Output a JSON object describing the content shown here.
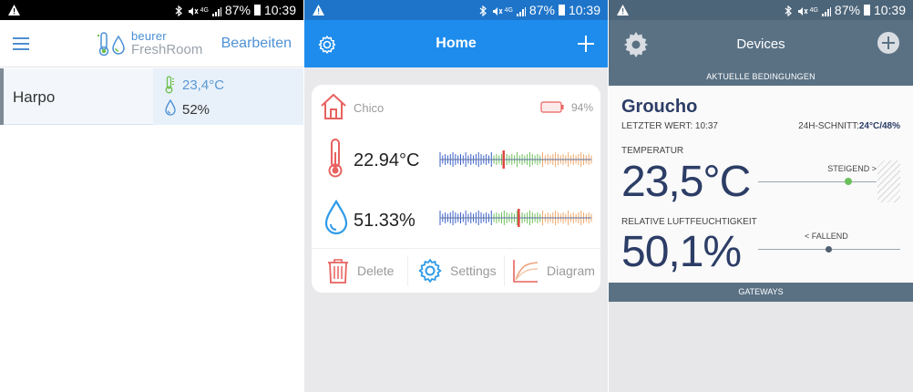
{
  "status": {
    "battery_pct": "87%",
    "time": "10:39",
    "network": "4G"
  },
  "screen1": {
    "edit_label": "Bearbeiten",
    "logo_line1": "beurer",
    "logo_line2": "FreshRoom",
    "device": {
      "name": "Harpo",
      "temperature": "23,4°C",
      "humidity": "52%"
    },
    "colors": {
      "accent": "#4f92d5"
    }
  },
  "screen2": {
    "title": "Home",
    "device_name": "Chico",
    "battery": "94%",
    "temperature": "22.94°C",
    "humidity": "51.33%",
    "actions": {
      "delete": "Delete",
      "settings": "Settings",
      "diagram": "Diagram"
    },
    "colors": {
      "header": "#1e8cec",
      "accent": "#e8625f"
    }
  },
  "screen3": {
    "title": "Devices",
    "section_conditions": "AKTUELLE BEDINGUNGEN",
    "device_name": "Groucho",
    "last_value": "LETZTER WERT: 10:37",
    "avg_label": "24H-SCHNITT:",
    "avg_value": "24°C/48%",
    "temp_label": "TEMPERATUR",
    "temp_value": "23,5°C",
    "temp_trend": "STEIGEND >",
    "hum_label": "RELATIVE LUFTFEUCHTIGKEIT",
    "hum_value": "50,1%",
    "hum_trend": "< FALLEND",
    "section_gateways": "GATEWAYS",
    "colors": {
      "header": "#5a7184",
      "text": "#2c3d66"
    }
  }
}
